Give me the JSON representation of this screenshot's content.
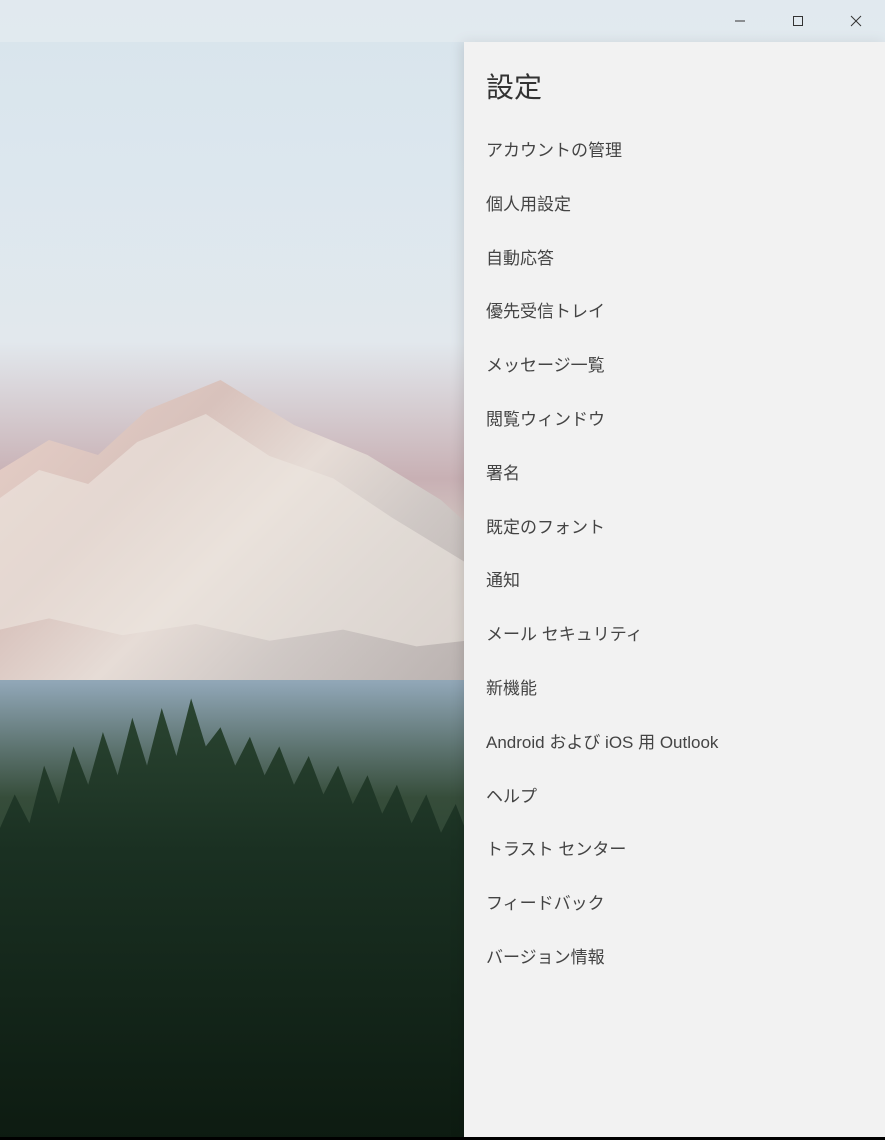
{
  "settings": {
    "title": "設定",
    "items": [
      {
        "label": "アカウントの管理",
        "key": "manage-accounts"
      },
      {
        "label": "個人用設定",
        "key": "personalization"
      },
      {
        "label": "自動応答",
        "key": "automatic-replies"
      },
      {
        "label": "優先受信トレイ",
        "key": "focused-inbox"
      },
      {
        "label": "メッセージ一覧",
        "key": "message-list"
      },
      {
        "label": "閲覧ウィンドウ",
        "key": "reading-pane"
      },
      {
        "label": "署名",
        "key": "signature"
      },
      {
        "label": "既定のフォント",
        "key": "default-font"
      },
      {
        "label": "通知",
        "key": "notifications"
      },
      {
        "label": "メール セキュリティ",
        "key": "mail-security"
      },
      {
        "label": "新機能",
        "key": "whats-new"
      },
      {
        "label": "Android および iOS 用 Outlook",
        "key": "outlook-mobile"
      },
      {
        "label": "ヘルプ",
        "key": "help"
      },
      {
        "label": "トラスト センター",
        "key": "trust-center"
      },
      {
        "label": "フィードバック",
        "key": "feedback"
      },
      {
        "label": "バージョン情報",
        "key": "about"
      }
    ]
  }
}
